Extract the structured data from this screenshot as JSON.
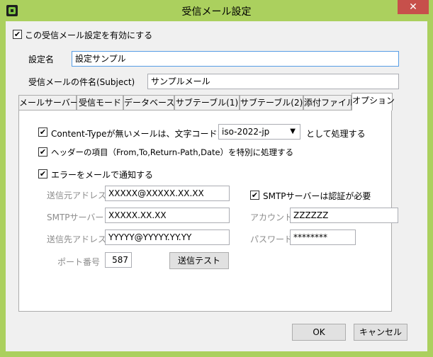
{
  "window": {
    "title": "受信メール設定",
    "close_label": "✕"
  },
  "enable": {
    "label": "この受信メール設定を有効にする",
    "checked": true
  },
  "setting_name": {
    "label": "設定名",
    "value": "設定サンプル"
  },
  "subject": {
    "label": "受信メールの件名(Subject)",
    "value": "サンプルメール"
  },
  "tabs": [
    {
      "label": "メールサーバー"
    },
    {
      "label": "受信モード"
    },
    {
      "label": "データベース"
    },
    {
      "label": "サブテーブル(1)"
    },
    {
      "label": "サブテーブル(2)"
    },
    {
      "label": "添付ファイル"
    },
    {
      "label": "オプション"
    }
  ],
  "options": {
    "content_type_label": "Content-Typeが無いメールは、文字コードを",
    "charset_value": "iso-2022-jp",
    "content_type_suffix": "として処理する",
    "header_label": "ヘッダーの項目（From,To,Return-Path,Date）を特別に処理する",
    "notify_label": "エラーをメールで通知する",
    "from_label": "送信元アドレス",
    "from_value": "XXXXX@XXXXX.XX.XX",
    "smtp_server_label": "SMTPサーバー",
    "smtp_server_value": "XXXXX.XX.XX",
    "to_label": "送信先アドレス",
    "to_value": "YYYYY@YYYYY.YY.YY",
    "port_label": "ポート番号",
    "port_value": "587",
    "test_button": "送信テスト",
    "smtp_auth_label": "SMTPサーバーは認証が必要",
    "account_label": "アカウント",
    "account_value": "ZZZZZZ",
    "password_label": "パスワード",
    "password_value": "********"
  },
  "footer": {
    "ok": "OK",
    "cancel": "キャンセル"
  },
  "colors": {
    "frame": "#ABD05E",
    "close": "#C7504B",
    "dialog_bg": "#F0F0F0"
  }
}
